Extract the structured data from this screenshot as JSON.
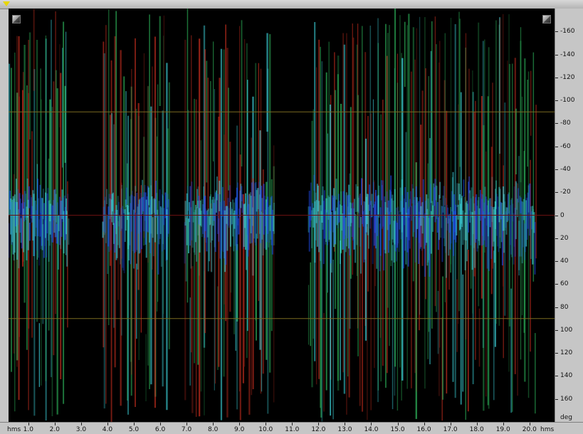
{
  "display": {
    "x_axis": {
      "unit_left": "hms",
      "unit_right": "hms",
      "ticks": [
        "1.0",
        "2.0",
        "3.0",
        "4.0",
        "5.0",
        "6.0",
        "7.0",
        "8.0",
        "9.0",
        "10.0",
        "11.0",
        "12.0",
        "13.0",
        "14.0",
        "15.0",
        "16.0",
        "17.0",
        "18.0",
        "19.0",
        "20.0"
      ],
      "range_seconds": [
        0.25,
        20.95
      ]
    },
    "y_axis": {
      "unit": "deg",
      "ticks": [
        "-160",
        "-140",
        "-120",
        "-100",
        "-80",
        "-60",
        "-40",
        "-20",
        "0",
        "20",
        "40",
        "60",
        "80",
        "100",
        "120",
        "140",
        "160"
      ],
      "range_deg": [
        -180,
        180
      ]
    },
    "guide_lines_deg": [
      -90,
      0,
      90
    ],
    "colors": {
      "background": "#000000",
      "guide_line": "#7a6a20",
      "center_line": "#6a1010",
      "low": "#d03020",
      "mid": "#30c060",
      "high": "#40e0e8",
      "center_energy": "#2050ff",
      "playhead": "#e8d600"
    },
    "controls": {
      "left_corner_icon": "zoom-corner-icon",
      "right_corner_icon": "zoom-corner-icon",
      "playhead_icon": "playhead-triangle-icon"
    }
  }
}
